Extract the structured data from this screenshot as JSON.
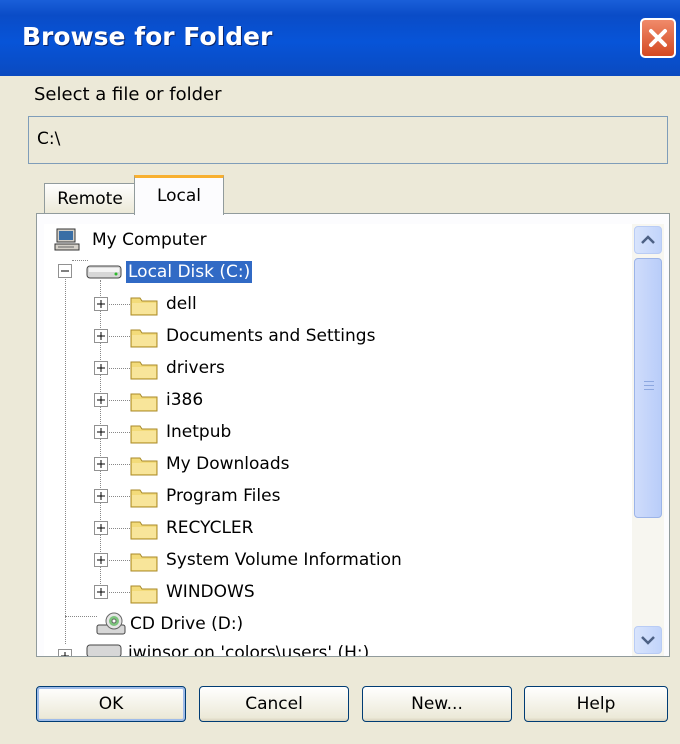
{
  "window": {
    "title": "Browse for Folder",
    "close_icon": "close-icon"
  },
  "prompt": "Select a file or folder",
  "selected_path": "C:\\",
  "tabs": [
    {
      "label": "Remote",
      "active": false
    },
    {
      "label": "Local",
      "active": true
    }
  ],
  "tree": {
    "root": {
      "label": "My Computer",
      "icon": "computer-icon"
    },
    "drive_c": {
      "label": "Local Disk (C:)",
      "icon": "hard-drive-icon",
      "expanded": true,
      "selected": true
    },
    "folders": [
      "dell",
      "Documents and Settings",
      "drivers",
      "i386",
      "Inetpub",
      "My Downloads",
      "Program Files",
      "RECYCLER",
      "System Volume Information",
      "WINDOWS"
    ],
    "drive_d": {
      "label": "CD Drive (D:)",
      "icon": "cd-drive-icon"
    },
    "drive_h": {
      "label": "iwinsor on 'colors\\users' (H:)",
      "icon": "network-drive-icon"
    }
  },
  "buttons": {
    "ok": "OK",
    "cancel": "Cancel",
    "new": "New...",
    "help": "Help"
  },
  "colors": {
    "titlebar": "#0a4cc7",
    "selection": "#316ac5",
    "dialog_bg": "#ece9d8",
    "tab_highlight": "#f8b030"
  }
}
